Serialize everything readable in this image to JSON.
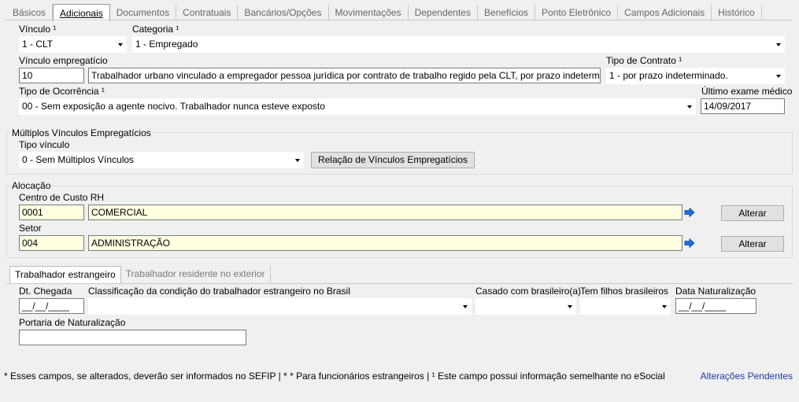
{
  "tabs": [
    {
      "label": "Básicos"
    },
    {
      "label": "Adicionais"
    },
    {
      "label": "Documentos"
    },
    {
      "label": "Contratuais"
    },
    {
      "label": "Bancários/Opções"
    },
    {
      "label": "Movimentações"
    },
    {
      "label": "Dependentes"
    },
    {
      "label": "Benefícios"
    },
    {
      "label": "Ponto Eletrônico"
    },
    {
      "label": "Campos Adicionais"
    },
    {
      "label": "Histórico"
    }
  ],
  "vinculo": {
    "label": "Vínculo ¹",
    "value": "1 - CLT"
  },
  "categoria": {
    "label": "Categoria ¹",
    "value": "1  - Empregado"
  },
  "vinculo_empregaticio": {
    "label": "Vínculo empregatício",
    "code": "10",
    "description": "Trabalhador urbano vinculado a empregador pessoa jurídica por contrato de trabalho regido pela CLT, por prazo indeterminado."
  },
  "tipo_contrato": {
    "label": "Tipo de Contrato ¹",
    "value": "1 - por prazo indeterminado."
  },
  "tipo_ocorrencia": {
    "label": "Tipo de Ocorrência ¹",
    "value": "00 - Sem exposição a agente nocivo. Trabalhador nunca esteve exposto"
  },
  "ultimo_exame": {
    "label": "Último exame médico",
    "value": "14/09/2017"
  },
  "multiplos": {
    "title": "Múltiplos Vínculos Empregatícios",
    "tipo_label": "Tipo vínculo",
    "tipo_value": "0 - Sem Múltiplos Vínculos",
    "button": "Relação de Vínculos Empregatícios"
  },
  "alocacao": {
    "title": "Alocação",
    "centro_label": "Centro de Custo RH",
    "centro_code": "0001",
    "centro_name": "COMERCIAL",
    "setor_label": "Setor",
    "setor_code": "004",
    "setor_name": "ADMINISTRAÇÃO",
    "alterar": "Alterar"
  },
  "subtabs": [
    {
      "label": "Trabalhador estrangeiro"
    },
    {
      "label": "Trabalhador residente no exterior"
    }
  ],
  "estrangeiro": {
    "dt_chegada_label": "Dt. Chegada",
    "dt_chegada_value": "__/__/____",
    "classificacao_label": "Classificação da condição do trabalhador estrangeiro no Brasil",
    "classificacao_value": "",
    "casado_label": "Casado com brasileiro(a)",
    "casado_value": "",
    "filhos_label": "Tem filhos brasileiros",
    "filhos_value": "",
    "data_nat_label": "Data Naturalização",
    "data_nat_value": "__/__/____",
    "portaria_label": "Portaria de Naturalização",
    "portaria_value": ""
  },
  "footer": {
    "note": "* Esses campos, se alterados, deverão ser informados no SEFIP | * * Para funcionários estrangeiros |  ¹  Este campo possui informação semelhante no eSocial",
    "link": "Alterações Pendentes"
  },
  "colors": {
    "accent_link": "#1a3aa8",
    "yellow_field": "#ffffe1",
    "arrow_blue": "#1e6fd9"
  }
}
